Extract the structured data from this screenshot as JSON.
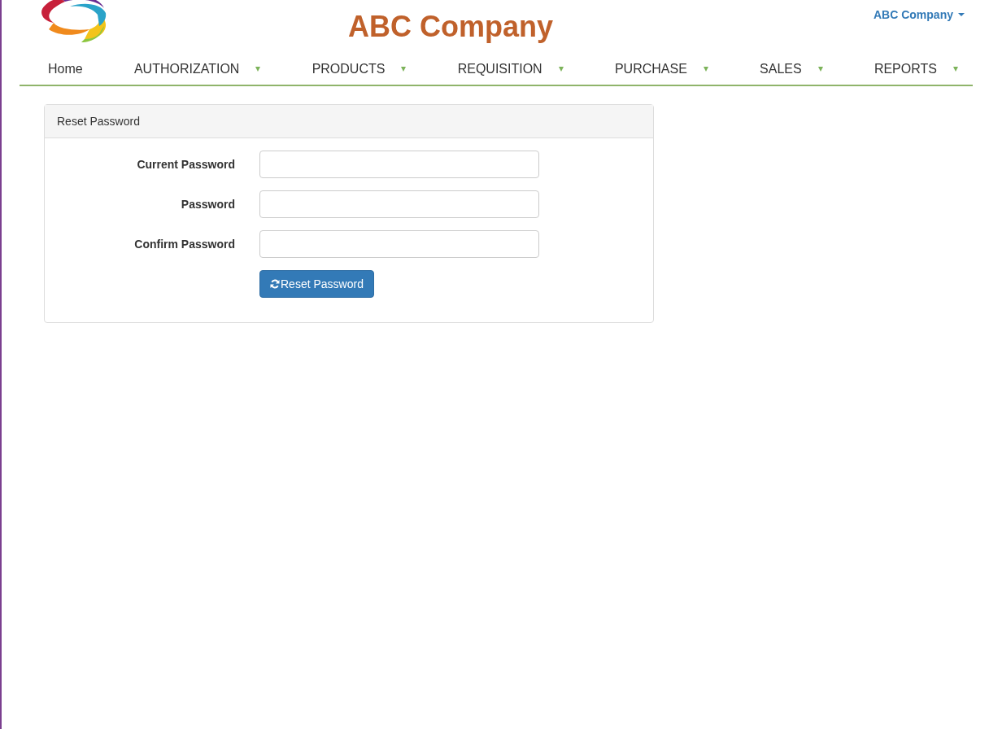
{
  "header": {
    "title": "ABC Company",
    "user_menu": "ABC Company"
  },
  "nav": [
    {
      "label": "Home",
      "has_menu": false
    },
    {
      "label": "AUTHORIZATION",
      "has_menu": true
    },
    {
      "label": "PRODUCTS",
      "has_menu": true
    },
    {
      "label": "REQUISITION",
      "has_menu": true
    },
    {
      "label": "PURCHASE",
      "has_menu": true
    },
    {
      "label": "SALES",
      "has_menu": true
    },
    {
      "label": "REPORTS",
      "has_menu": true
    }
  ],
  "panel": {
    "title": "Reset Password",
    "fields": [
      {
        "label": "Current Password"
      },
      {
        "label": "Password"
      },
      {
        "label": "Confirm Password"
      }
    ],
    "button": "Reset Password"
  }
}
